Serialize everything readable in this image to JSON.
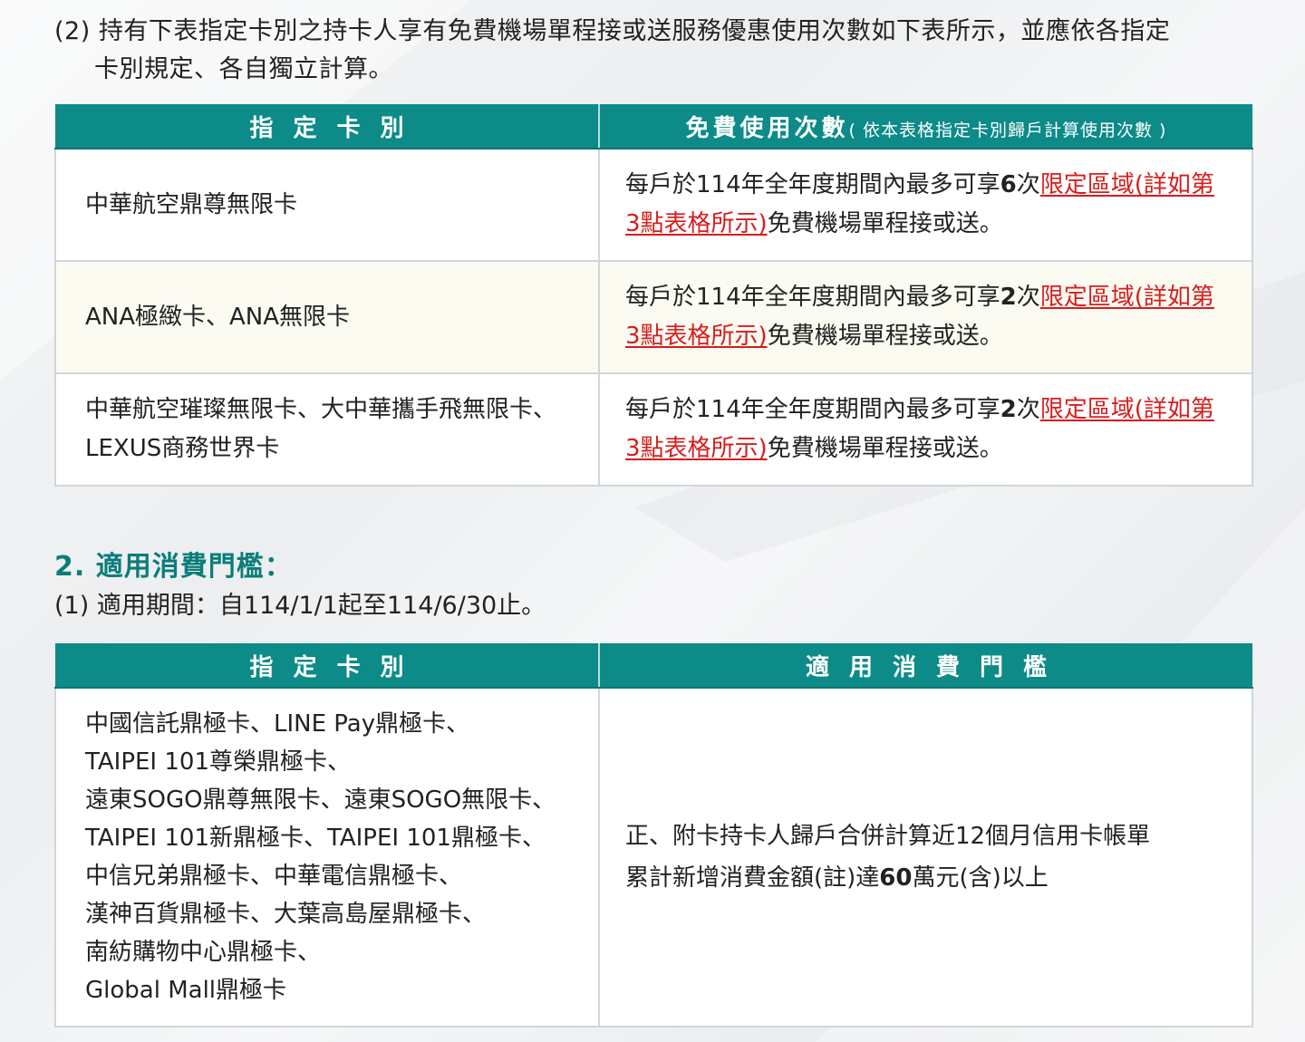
{
  "intro": {
    "line1": "(2) 持有下表指定卡別之持卡人享有免費機場單程接或送服務優惠使用次數如下表所示，並應依各指定",
    "line2": "卡別規定、各自獨立計算。"
  },
  "table1": {
    "header_card": "指定卡別",
    "header_count": "免費使用次數",
    "header_note": "( 依本表格指定卡別歸戶計算使用次數 )",
    "rows": [
      {
        "card_lines": [
          "中華航空鼎尊無限卡"
        ],
        "pre": "每戶於114年全年度期間內最多可享",
        "count": "6",
        "unit": "次",
        "link": "限定區域(詳如第3點表格所示)",
        "post": "免費機場單程接或送。"
      },
      {
        "card_lines": [
          "ANA極緻卡、ANA無限卡"
        ],
        "pre": "每戶於114年全年度期間內最多可享",
        "count": "2",
        "unit": "次",
        "link": "限定區域(詳如第3點表格所示)",
        "post": "免費機場單程接或送。"
      },
      {
        "card_lines": [
          "中華航空璀璨無限卡、大中華攜手飛無限卡、",
          "LEXUS商務世界卡"
        ],
        "pre": "每戶於114年全年度期間內最多可享",
        "count": "2",
        "unit": "次",
        "link": "限定區域(詳如第3點表格所示)",
        "post": "免費機場單程接或送。"
      }
    ]
  },
  "section2": {
    "heading": "2. 適用消費門檻：",
    "period": "(1) 適用期間：自114/1/1起至114/6/30止。"
  },
  "table2": {
    "header_card": "指定卡別",
    "header_threshold": "適用消費門檻",
    "card_lines": [
      "中國信託鼎極卡、LINE Pay鼎極卡、",
      "TAIPEI 101尊榮鼎極卡、",
      "遠東SOGO鼎尊無限卡、遠東SOGO無限卡、",
      "TAIPEI 101新鼎極卡、TAIPEI 101鼎極卡、",
      "中信兄弟鼎極卡、中華電信鼎極卡、",
      "漢神百貨鼎極卡、大葉高島屋鼎極卡、",
      "南紡購物中心鼎極卡、",
      "Global Mall鼎極卡"
    ],
    "threshold_line1": "正、附卡持卡人歸戶合併計算近12個月信用卡帳單",
    "threshold_pre": "累計新增消費金額(註)達",
    "threshold_amount": "60",
    "threshold_post": "萬元(含)以上"
  },
  "colors": {
    "header_teal": "#0c8b88",
    "heading_teal": "#0a7d79",
    "link_red": "#d81d1d",
    "alt_row": "#fbfbf2"
  }
}
